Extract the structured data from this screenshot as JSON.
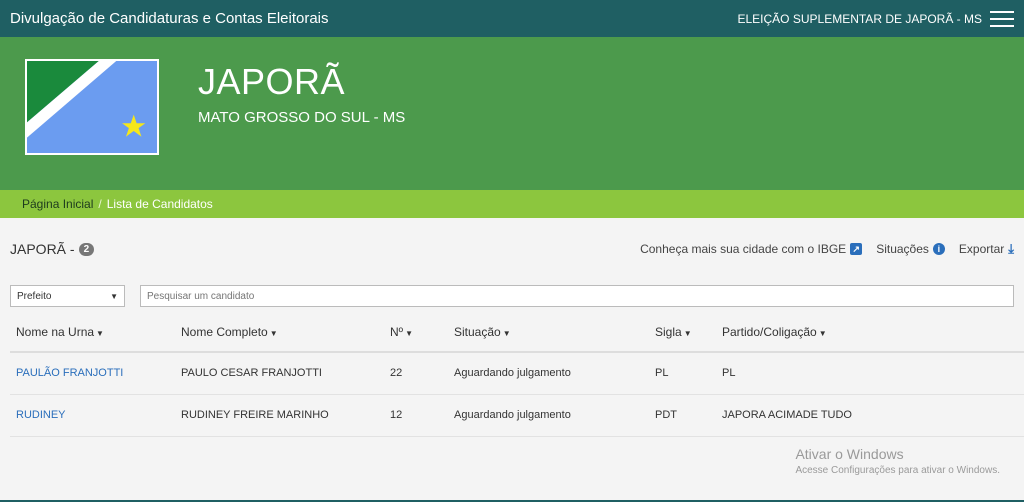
{
  "header": {
    "app_title": "Divulgação de Candidaturas e Contas Eleitorais",
    "election_label": "ELEIÇÃO SUPLEMENTAR DE JAPORÃ - MS",
    "menu_icon": "hamburger-icon"
  },
  "hero": {
    "city": "JAPORÃ",
    "state": "MATO GROSSO DO SUL - MS",
    "flag_colors": {
      "green": "#1a8a3c",
      "blue": "#6b9cf0",
      "star": "#f5e71a",
      "white": "#ffffff"
    }
  },
  "breadcrumb": {
    "home": "Página Inicial",
    "separator": "/",
    "current": "Lista de Candidatos"
  },
  "list": {
    "title": "JAPORÃ -",
    "count": "2",
    "links": {
      "ibge": "Conheça mais sua cidade com o IBGE",
      "situacoes": "Situações",
      "exportar": "Exportar"
    }
  },
  "filters": {
    "office_selected": "Prefeito",
    "search_placeholder": "Pesquisar um candidato"
  },
  "table": {
    "columns": [
      "Nome na Urna",
      "Nome Completo",
      "Nº",
      "Situação",
      "Sigla",
      "Partido/Coligação"
    ],
    "rows": [
      [
        "PAULÃO FRANJOTTI",
        "PAULO CESAR FRANJOTTI",
        "22",
        "Aguardando julgamento",
        "PL",
        "PL"
      ],
      [
        "RUDINEY",
        "RUDINEY FREIRE MARINHO",
        "12",
        "Aguardando julgamento",
        "PDT",
        "JAPORA ACIMADE TUDO"
      ]
    ]
  },
  "watermark": {
    "title": "Ativar o Windows",
    "subtitle": "Acesse Configurações para ativar o Windows."
  },
  "colors": {
    "topbar": "#1f5f63",
    "hero": "#4c9a4c",
    "breadcrumb": "#8cc63e",
    "link": "#2a6ebb"
  }
}
